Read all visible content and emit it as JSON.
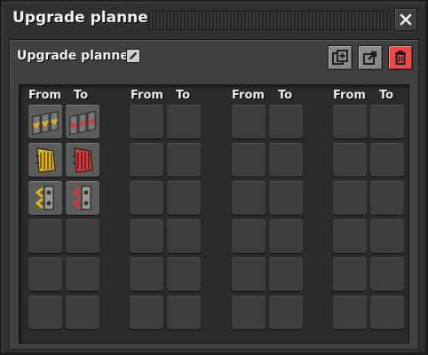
{
  "window": {
    "title": "Upgrade planner"
  },
  "planner": {
    "name": "Upgrade planner"
  },
  "toolbar": {
    "copy_icon": "copy-plus-icon",
    "export_icon": "export-icon",
    "delete_icon": "trash-icon"
  },
  "columns": [
    "From",
    "To",
    "From",
    "To",
    "From",
    "To",
    "From",
    "To"
  ],
  "mappings": [
    {
      "from": "transport-belt-icon",
      "to": "fast-transport-belt-icon"
    },
    {
      "from": "underground-belt-icon",
      "to": "fast-underground-belt-icon"
    },
    {
      "from": "splitter-icon",
      "to": "fast-splitter-icon"
    }
  ],
  "colors": {
    "yellow_tier": "#e0b21c",
    "red_tier": "#d43c3c",
    "delete_button": "#e84b4b"
  }
}
